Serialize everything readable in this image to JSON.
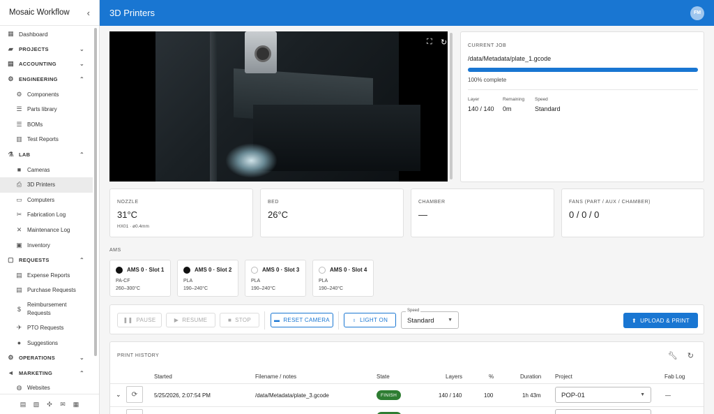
{
  "app": {
    "title": "Mosaic Workflow",
    "collapse_icon": "chevron-left-icon"
  },
  "header": {
    "title": "3D Printers",
    "avatar": "FM"
  },
  "sidebar": {
    "items": [
      {
        "label": "Dashboard",
        "icon": "dashboard-icon",
        "kind": "top"
      },
      {
        "label": "PROJECTS",
        "icon": "folder-icon",
        "kind": "section",
        "chevron": "down"
      },
      {
        "label": "ACCOUNTING",
        "icon": "account-icon",
        "kind": "section",
        "chevron": "down"
      },
      {
        "label": "ENGINEERING",
        "icon": "engineering-icon",
        "kind": "section",
        "chevron": "up"
      },
      {
        "label": "Components",
        "icon": "gear-icon",
        "kind": "sub"
      },
      {
        "label": "Parts library",
        "icon": "list-icon",
        "kind": "sub"
      },
      {
        "label": "BOMs",
        "icon": "list-icon",
        "kind": "sub"
      },
      {
        "label": "Test Reports",
        "icon": "chart-icon",
        "kind": "sub"
      },
      {
        "label": "LAB",
        "icon": "flask-icon",
        "kind": "section",
        "chevron": "up"
      },
      {
        "label": "Cameras",
        "icon": "camera-icon",
        "kind": "sub"
      },
      {
        "label": "3D Printers",
        "icon": "printer-icon",
        "kind": "sub",
        "active": true
      },
      {
        "label": "Computers",
        "icon": "laptop-icon",
        "kind": "sub"
      },
      {
        "label": "Fabrication Log",
        "icon": "tool-icon",
        "kind": "sub"
      },
      {
        "label": "Maintenance Log",
        "icon": "wrench-icon",
        "kind": "sub"
      },
      {
        "label": "Inventory",
        "icon": "inventory-icon",
        "kind": "sub"
      },
      {
        "label": "REQUESTS",
        "icon": "inbox-icon",
        "kind": "section",
        "chevron": "up"
      },
      {
        "label": "Expense Reports",
        "icon": "receipt-icon",
        "kind": "sub"
      },
      {
        "label": "Purchase Requests",
        "icon": "cart-icon",
        "kind": "sub"
      },
      {
        "label": "Reimbursement Requests",
        "icon": "dollar-icon",
        "kind": "sub2"
      },
      {
        "label": "PTO Requests",
        "icon": "plane-icon",
        "kind": "sub"
      },
      {
        "label": "Suggestions",
        "icon": "bulb-icon",
        "kind": "sub"
      },
      {
        "label": "OPERATIONS",
        "icon": "gear-icon",
        "kind": "section",
        "chevron": "down"
      },
      {
        "label": "MARKETING",
        "icon": "megaphone-icon",
        "kind": "section",
        "chevron": "up"
      },
      {
        "label": "Websites",
        "icon": "globe-icon",
        "kind": "sub"
      }
    ],
    "footer_icons": [
      "document-icon",
      "book-icon",
      "slack-icon",
      "mail-icon",
      "calendar-icon"
    ]
  },
  "camera": {
    "fullscreen_icon": "fullscreen-icon",
    "refresh_icon": "refresh-icon"
  },
  "job": {
    "caption": "CURRENT JOB",
    "path": "/data/Metadata/plate_1.gcode",
    "progress": 1.0,
    "progress_text": "100% complete",
    "layer_label": "Layer",
    "layer_value": "140 / 140",
    "remaining_label": "Remaining",
    "remaining_value": "0m",
    "speed_label": "Speed",
    "speed_value": "Standard"
  },
  "temps": [
    {
      "caption": "NOZZLE",
      "value": "31°C",
      "sub": "HX01 · ø0.4mm"
    },
    {
      "caption": "BED",
      "value": "26°C",
      "sub": ""
    },
    {
      "caption": "CHAMBER",
      "value": "—",
      "sub": ""
    },
    {
      "caption": "FANS (PART / AUX / CHAMBER)",
      "value": "0 / 0 / 0",
      "sub": ""
    }
  ],
  "ams": {
    "label": "AMS",
    "slots": [
      {
        "name": "AMS 0 · Slot 1",
        "material": "PA-CF",
        "range": "260–300°C",
        "color": "#111111",
        "filled": true
      },
      {
        "name": "AMS 0 · Slot 2",
        "material": "PLA",
        "range": "190–240°C",
        "color": "#111111",
        "filled": true
      },
      {
        "name": "AMS 0 · Slot 3",
        "material": "PLA",
        "range": "190–240°C",
        "color": "#ffffff",
        "filled": false
      },
      {
        "name": "AMS 0 · Slot 4",
        "material": "PLA",
        "range": "190–240°C",
        "color": "#ffffff",
        "filled": false
      }
    ]
  },
  "controls": {
    "pause": "PAUSE",
    "resume": "RESUME",
    "stop": "STOP",
    "reset_camera": "RESET CAMERA",
    "light_on": "LIGHT ON",
    "speed_legend": "Speed",
    "speed_value": "Standard",
    "upload_print": "UPLOAD & PRINT"
  },
  "history": {
    "caption": "PRINT HISTORY",
    "headers": {
      "started": "Started",
      "filename": "Filename / notes",
      "state": "State",
      "layers": "Layers",
      "pct": "%",
      "duration": "Duration",
      "project": "Project",
      "fab_log": "Fab Log"
    },
    "rows": [
      {
        "started": "5/25/2026, 2:07:54 PM",
        "filename": "/data/Metadata/plate_3.gcode",
        "state": "FINISH",
        "layers": "140 / 140",
        "pct": "100",
        "duration": "1h 43m",
        "project": "POP-01",
        "fab_log": "—"
      }
    ]
  },
  "colors": {
    "primary": "#1976d2",
    "success": "#2e7d32"
  }
}
